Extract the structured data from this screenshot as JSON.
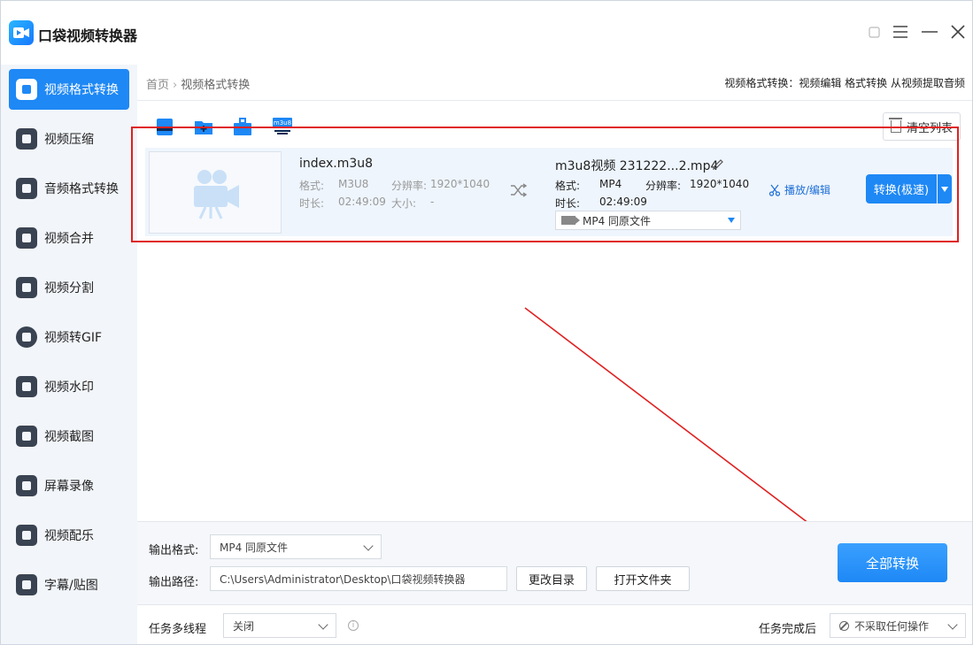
{
  "app": {
    "title": "口袋视频转换器",
    "logo_icon": "video-logo-icon"
  },
  "window_controls": [
    "restore-icon",
    "menu-icon",
    "minimize-icon",
    "close-icon"
  ],
  "sidebar": {
    "items": [
      {
        "label": "视频格式转换",
        "icon": "video-convert-icon",
        "active": true
      },
      {
        "label": "视频压缩",
        "icon": "compress-icon"
      },
      {
        "label": "音频格式转换",
        "icon": "audio-convert-icon"
      },
      {
        "label": "视频合并",
        "icon": "merge-icon"
      },
      {
        "label": "视频分割",
        "icon": "split-icon"
      },
      {
        "label": "视频转GIF",
        "icon": "gif-icon"
      },
      {
        "label": "视频水印",
        "icon": "watermark-icon"
      },
      {
        "label": "视频截图",
        "icon": "screenshot-icon"
      },
      {
        "label": "屏幕录像",
        "icon": "screen-record-icon"
      },
      {
        "label": "视频配乐",
        "icon": "music-icon"
      },
      {
        "label": "字幕/贴图",
        "icon": "subtitle-icon"
      }
    ]
  },
  "breadcrumb": {
    "home": "首页",
    "separator": "›",
    "current": "视频格式转换"
  },
  "top_right_text": "视频格式转换：视频编辑 格式转换 从视频提取音频",
  "toolbar": {
    "icons": [
      "add-file-icon",
      "add-folder-icon",
      "toolbox-icon",
      "m3u8-icon"
    ],
    "m3u8_label": "m3u8",
    "clear_list": "清空列表"
  },
  "file_item": {
    "source": {
      "name": "index.m3u8",
      "format_label": "格式:",
      "format": "M3U8",
      "resolution_label": "分辨率:",
      "resolution": "1920*1040",
      "duration_label": "时长:",
      "duration": "02:49:09",
      "size_label": "大小:",
      "size": "-"
    },
    "target": {
      "name": "m3u8视频 231222...2.mp4",
      "format_label": "格式:",
      "format": "MP4",
      "resolution_label": "分辨率:",
      "resolution": "1920*1040",
      "duration_label": "时长:",
      "duration": "02:49:09",
      "format_select": "MP4  同原文件"
    },
    "edit_link": "播放/编辑",
    "convert_button": "转换(极速)"
  },
  "bottom": {
    "output_format_label": "输出格式:",
    "output_format_value": "MP4  同原文件",
    "output_path_label": "输出路径:",
    "output_path_value": "C:\\Users\\Administrator\\Desktop\\口袋视频转换器",
    "change_dir": "更改目录",
    "open_folder": "打开文件夹",
    "convert_all": "全部转换",
    "multithread_label": "任务多线程",
    "multithread_value": "关闭",
    "info_glyph": "i",
    "after_done_label": "任务完成后",
    "after_done_value": "不采取任何操作"
  },
  "colors": {
    "accent": "#1e88f5",
    "annotation_red": "#e02020",
    "sidebar_bg": "#f2f5f9"
  }
}
